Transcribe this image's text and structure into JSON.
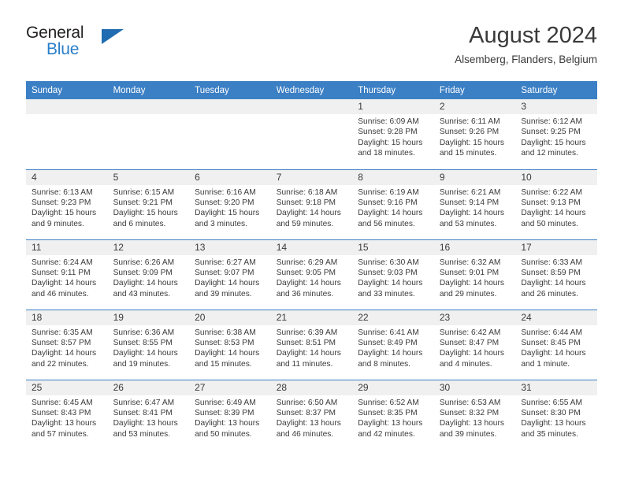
{
  "brand": {
    "line1": "General",
    "line2": "Blue",
    "triangle_color": "#1f6cb0",
    "text_color": "#231f20",
    "accent_color": "#2a7fc9"
  },
  "header": {
    "title": "August 2024",
    "subtitle": "Alsemberg, Flanders, Belgium"
  },
  "theme": {
    "header_bg": "#3b7fc4",
    "header_text": "#ffffff",
    "daynum_bg": "#f0f0f0",
    "body_text": "#3a3a3a",
    "rule_color": "#3b7fc4"
  },
  "weekday_headers": [
    "Sunday",
    "Monday",
    "Tuesday",
    "Wednesday",
    "Thursday",
    "Friday",
    "Saturday"
  ],
  "labels": {
    "sunrise_prefix": "Sunrise:",
    "sunset_prefix": "Sunset:",
    "daylight_prefix": "Daylight:"
  },
  "weeks": [
    [
      {
        "day": "",
        "sunrise": "",
        "sunset": "",
        "daylight": "",
        "blank": true
      },
      {
        "day": "",
        "sunrise": "",
        "sunset": "",
        "daylight": "",
        "blank": true
      },
      {
        "day": "",
        "sunrise": "",
        "sunset": "",
        "daylight": "",
        "blank": true
      },
      {
        "day": "",
        "sunrise": "",
        "sunset": "",
        "daylight": "",
        "blank": true
      },
      {
        "day": "1",
        "sunrise": "Sunrise: 6:09 AM",
        "sunset": "Sunset: 9:28 PM",
        "daylight": "Daylight: 15 hours and 18 minutes."
      },
      {
        "day": "2",
        "sunrise": "Sunrise: 6:11 AM",
        "sunset": "Sunset: 9:26 PM",
        "daylight": "Daylight: 15 hours and 15 minutes."
      },
      {
        "day": "3",
        "sunrise": "Sunrise: 6:12 AM",
        "sunset": "Sunset: 9:25 PM",
        "daylight": "Daylight: 15 hours and 12 minutes."
      }
    ],
    [
      {
        "day": "4",
        "sunrise": "Sunrise: 6:13 AM",
        "sunset": "Sunset: 9:23 PM",
        "daylight": "Daylight: 15 hours and 9 minutes."
      },
      {
        "day": "5",
        "sunrise": "Sunrise: 6:15 AM",
        "sunset": "Sunset: 9:21 PM",
        "daylight": "Daylight: 15 hours and 6 minutes."
      },
      {
        "day": "6",
        "sunrise": "Sunrise: 6:16 AM",
        "sunset": "Sunset: 9:20 PM",
        "daylight": "Daylight: 15 hours and 3 minutes."
      },
      {
        "day": "7",
        "sunrise": "Sunrise: 6:18 AM",
        "sunset": "Sunset: 9:18 PM",
        "daylight": "Daylight: 14 hours and 59 minutes."
      },
      {
        "day": "8",
        "sunrise": "Sunrise: 6:19 AM",
        "sunset": "Sunset: 9:16 PM",
        "daylight": "Daylight: 14 hours and 56 minutes."
      },
      {
        "day": "9",
        "sunrise": "Sunrise: 6:21 AM",
        "sunset": "Sunset: 9:14 PM",
        "daylight": "Daylight: 14 hours and 53 minutes."
      },
      {
        "day": "10",
        "sunrise": "Sunrise: 6:22 AM",
        "sunset": "Sunset: 9:13 PM",
        "daylight": "Daylight: 14 hours and 50 minutes."
      }
    ],
    [
      {
        "day": "11",
        "sunrise": "Sunrise: 6:24 AM",
        "sunset": "Sunset: 9:11 PM",
        "daylight": "Daylight: 14 hours and 46 minutes."
      },
      {
        "day": "12",
        "sunrise": "Sunrise: 6:26 AM",
        "sunset": "Sunset: 9:09 PM",
        "daylight": "Daylight: 14 hours and 43 minutes."
      },
      {
        "day": "13",
        "sunrise": "Sunrise: 6:27 AM",
        "sunset": "Sunset: 9:07 PM",
        "daylight": "Daylight: 14 hours and 39 minutes."
      },
      {
        "day": "14",
        "sunrise": "Sunrise: 6:29 AM",
        "sunset": "Sunset: 9:05 PM",
        "daylight": "Daylight: 14 hours and 36 minutes."
      },
      {
        "day": "15",
        "sunrise": "Sunrise: 6:30 AM",
        "sunset": "Sunset: 9:03 PM",
        "daylight": "Daylight: 14 hours and 33 minutes."
      },
      {
        "day": "16",
        "sunrise": "Sunrise: 6:32 AM",
        "sunset": "Sunset: 9:01 PM",
        "daylight": "Daylight: 14 hours and 29 minutes."
      },
      {
        "day": "17",
        "sunrise": "Sunrise: 6:33 AM",
        "sunset": "Sunset: 8:59 PM",
        "daylight": "Daylight: 14 hours and 26 minutes."
      }
    ],
    [
      {
        "day": "18",
        "sunrise": "Sunrise: 6:35 AM",
        "sunset": "Sunset: 8:57 PM",
        "daylight": "Daylight: 14 hours and 22 minutes."
      },
      {
        "day": "19",
        "sunrise": "Sunrise: 6:36 AM",
        "sunset": "Sunset: 8:55 PM",
        "daylight": "Daylight: 14 hours and 19 minutes."
      },
      {
        "day": "20",
        "sunrise": "Sunrise: 6:38 AM",
        "sunset": "Sunset: 8:53 PM",
        "daylight": "Daylight: 14 hours and 15 minutes."
      },
      {
        "day": "21",
        "sunrise": "Sunrise: 6:39 AM",
        "sunset": "Sunset: 8:51 PM",
        "daylight": "Daylight: 14 hours and 11 minutes."
      },
      {
        "day": "22",
        "sunrise": "Sunrise: 6:41 AM",
        "sunset": "Sunset: 8:49 PM",
        "daylight": "Daylight: 14 hours and 8 minutes."
      },
      {
        "day": "23",
        "sunrise": "Sunrise: 6:42 AM",
        "sunset": "Sunset: 8:47 PM",
        "daylight": "Daylight: 14 hours and 4 minutes."
      },
      {
        "day": "24",
        "sunrise": "Sunrise: 6:44 AM",
        "sunset": "Sunset: 8:45 PM",
        "daylight": "Daylight: 14 hours and 1 minute."
      }
    ],
    [
      {
        "day": "25",
        "sunrise": "Sunrise: 6:45 AM",
        "sunset": "Sunset: 8:43 PM",
        "daylight": "Daylight: 13 hours and 57 minutes."
      },
      {
        "day": "26",
        "sunrise": "Sunrise: 6:47 AM",
        "sunset": "Sunset: 8:41 PM",
        "daylight": "Daylight: 13 hours and 53 minutes."
      },
      {
        "day": "27",
        "sunrise": "Sunrise: 6:49 AM",
        "sunset": "Sunset: 8:39 PM",
        "daylight": "Daylight: 13 hours and 50 minutes."
      },
      {
        "day": "28",
        "sunrise": "Sunrise: 6:50 AM",
        "sunset": "Sunset: 8:37 PM",
        "daylight": "Daylight: 13 hours and 46 minutes."
      },
      {
        "day": "29",
        "sunrise": "Sunrise: 6:52 AM",
        "sunset": "Sunset: 8:35 PM",
        "daylight": "Daylight: 13 hours and 42 minutes."
      },
      {
        "day": "30",
        "sunrise": "Sunrise: 6:53 AM",
        "sunset": "Sunset: 8:32 PM",
        "daylight": "Daylight: 13 hours and 39 minutes."
      },
      {
        "day": "31",
        "sunrise": "Sunrise: 6:55 AM",
        "sunset": "Sunset: 8:30 PM",
        "daylight": "Daylight: 13 hours and 35 minutes."
      }
    ]
  ]
}
